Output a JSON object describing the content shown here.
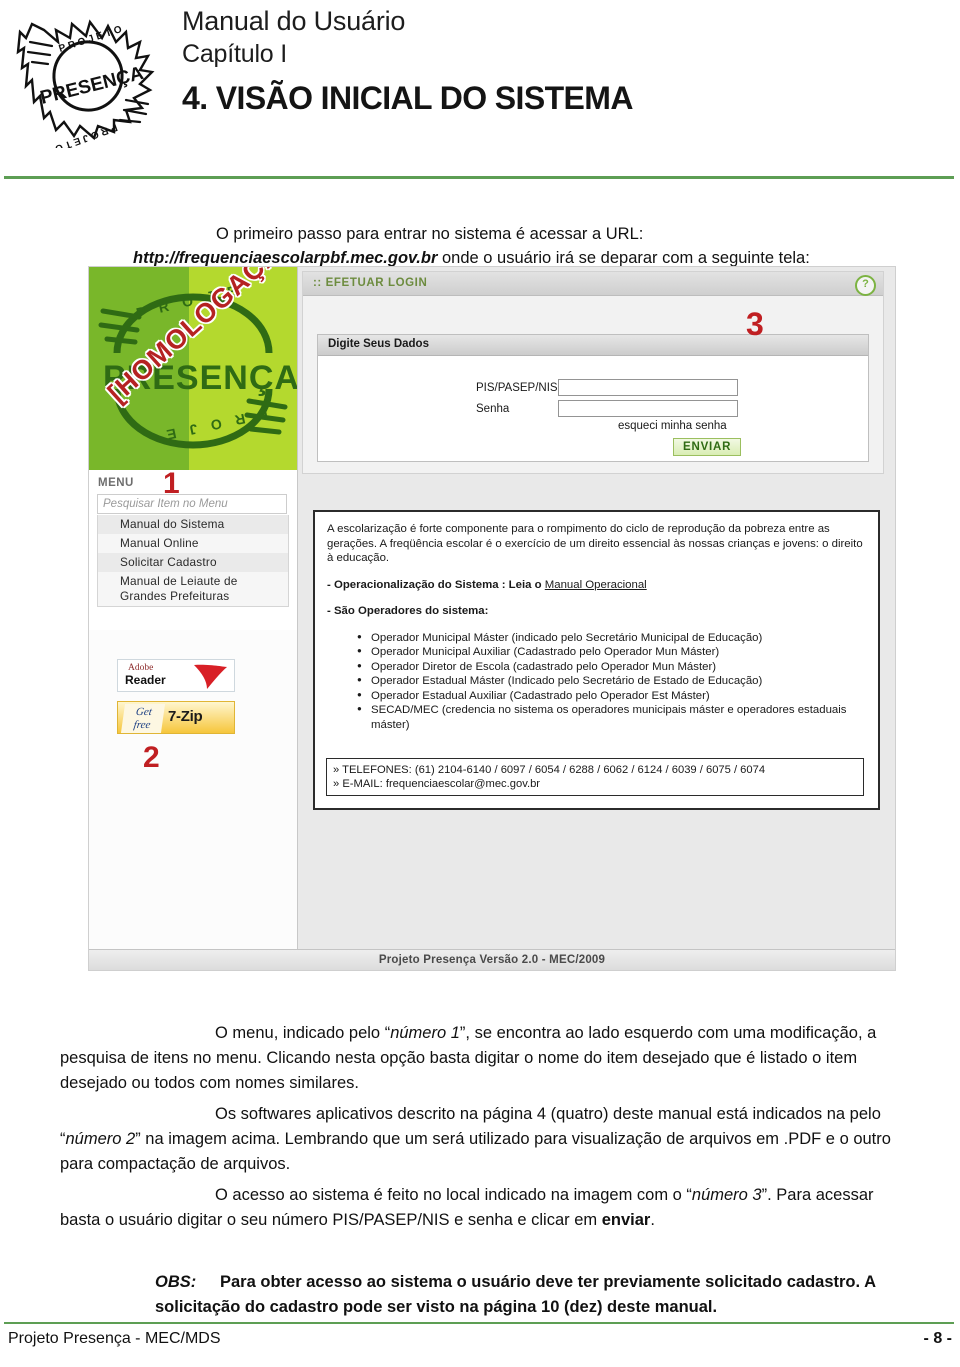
{
  "header": {
    "manual_title": "Manual do Usuário",
    "chapter": "Capítulo I",
    "section_title": "4. VISÃO INICIAL DO SISTEMA",
    "logo_alt": "PROJETO PRESENÇA",
    "rule_color": "#5d9e54"
  },
  "intro": {
    "text_before_url": "O  primeiro passo para entrar no sistema é acessar a URL: ",
    "url": "http://frequenciaescolarpbf.mec.gov.br",
    "text_after_url": " onde o usuário irá se deparar com a seguinte tela:"
  },
  "screenshot": {
    "banner": {
      "arc_top": "P R O J E",
      "brand": "PRESENÇA",
      "arc_bottom": "P R O J E",
      "stamp": "[HOMOLOGAÇÃO]",
      "green_dark": "#79b72a",
      "green_light": "#b4d92e",
      "brand_color": "#2f6b14",
      "stamp_color": "#b52222"
    },
    "menu": {
      "title": "MENU",
      "marker": "1",
      "marker_color": "#c01f22",
      "search_placeholder": "Pesquisar Item no Menu",
      "items": [
        "Manual do Sistema",
        "Manual Online",
        "Solicitar Cadastro",
        "Manual de Leiaute de Grandes Prefeituras"
      ]
    },
    "software": {
      "adobe_top": "Adobe",
      "adobe_bottom": "Reader",
      "zip_get": "Get",
      "zip_free": "free",
      "zip_name": "7-Zip",
      "marker": "2",
      "marker_color": "#c01f22"
    },
    "login": {
      "panel_title": ":: EFETUAR LOGIN",
      "help_icon": "?",
      "box_title": "Digite Seus Dados",
      "pis_label": "PIS/PASEP/NIS",
      "pis_value": "",
      "senha_label": "Senha",
      "senha_value": "",
      "forgot_link": "esqueci minha senha",
      "submit_label": "ENVIAR",
      "marker": "3",
      "marker_color": "#c01f22"
    },
    "info": {
      "paragraph": "A escolarização é forte componente para o rompimento do ciclo de reprodução da pobreza entre as gerações. A freqüência escolar é o exercício de um direito essencial às nossas crianças e jovens: o direito à educação.",
      "operational_prefix": "- Operacionalização do Sistema : Leia o ",
      "operational_link": "Manual Operacional",
      "operators_heading": "- São Operadores do sistema:",
      "operators": [
        "Operador Municipal Máster (indicado pelo Secretário Municipal de Educação)",
        "Operador Municipal Auxiliar (Cadastrado pelo Operador Mun Máster)",
        "Operador Diretor de Escola (cadastrado pelo Operador Mun Máster)",
        "Operador Estadual Máster (Indicado pelo Secretário de Estado de Educação)",
        "Operador Estadual Auxiliar (Cadastrado pelo Operador Est Máster)",
        "SECAD/MEC (credencia no sistema os operadores municipais máster e operadores estaduais máster)"
      ],
      "phones": "» TELEFONES: (61) 2104-6140 / 6097 / 6054 / 6288 / 6062 / 6124 / 6039 / 6075 / 6074",
      "email": "» E-MAIL: frequenciaescolar@mec.gov.br"
    },
    "footer": "Projeto Presença Versão 2.0 - MEC/2009"
  },
  "body": {
    "para_menu_1": "O menu, indicado pelo “",
    "para_menu_em": "número 1",
    "para_menu_2": "”, se encontra ao lado esquerdo com uma modificação, a pesquisa de itens no menu. Clicando nesta opção basta digitar o nome do item desejado que é listado o item desejado ou todos com nomes similares.",
    "para_soft_1": "Os  softwares aplicativos descrito na página 4 (quatro) deste manual  está indicados na pelo “",
    "para_soft_em": "número 2",
    "para_soft_2": "” na imagem acima. Lembrando que um será utilizado para visualização de arquivos em .PDF e o outro para compactação de arquivos.",
    "para_access_1": "O acesso ao sistema é feito no local indicado na imagem com o “",
    "para_access_em": "número 3",
    "para_access_2": "”. Para acessar basta o usuário digitar o seu número PIS/PASEP/NIS e senha e clicar em ",
    "para_access_bold": "enviar",
    "para_access_3": ".",
    "obs_label": "OBS:",
    "obs_text": "Para obter acesso ao sistema o usuário deve ter previamente solicitado cadastro. A solicitação do cadastro pode ser visto na página 10 (dez) deste manual."
  },
  "footer": {
    "left": "Projeto Presença - MEC/MDS",
    "right": "- 8 -",
    "rule_color": "#5d9e54"
  }
}
